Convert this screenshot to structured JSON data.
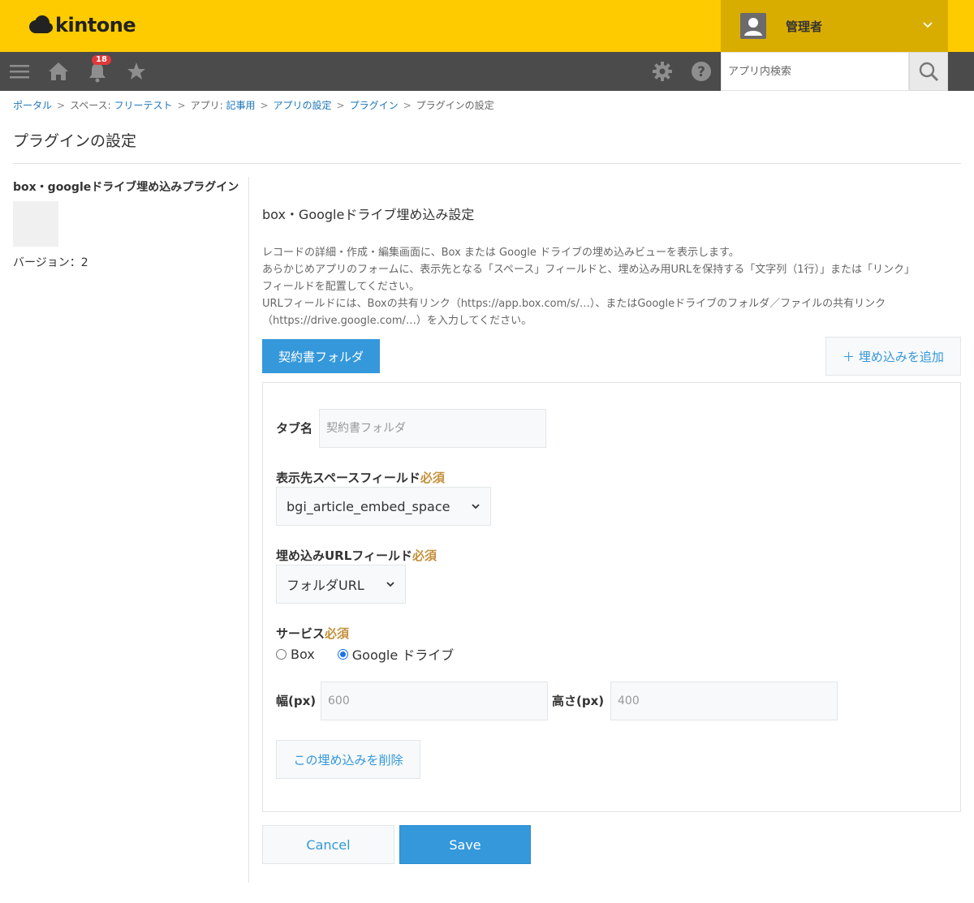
{
  "header": {
    "logo_text": "kintone",
    "user_name": "管理者",
    "notification_count": "18",
    "search_placeholder": "アプリ内検索",
    "brand_color": "#fdcb00",
    "navbar_color": "#4b4b4b"
  },
  "nav": {
    "icons": [
      "menu-icon",
      "home-icon",
      "bell-icon",
      "star-icon",
      "gear-icon",
      "help-icon",
      "search-icon"
    ]
  },
  "breadcrumb": {
    "portal": "ポータル",
    "space_prefix": "スペース: ",
    "space_name": "フリーテスト",
    "app_prefix": "アプリ: ",
    "app_name": "記事用",
    "app_settings": "アプリの設定",
    "plugins": "プラグイン",
    "current": "プラグインの設定",
    "separator": ">"
  },
  "page": {
    "title": "プラグインの設定"
  },
  "plugin": {
    "name": "box・googleドライブ埋め込みプラグイン",
    "version_label": "バージョン：2"
  },
  "settings": {
    "section_title": "box・Googleドライブ埋め込み設定",
    "description": [
      "レコードの詳細・作成・編集画面に、Box または Google ドライブの埋め込みビューを表示します。",
      "あらかじめアプリのフォームに、表示先となる「スペース」フィールドと、埋め込み用URLを保持する「文字列（1行）」または「リンク」",
      "フィールドを配置してください。",
      "URLフィールドには、Boxの共有リンク（https://app.box.com/s/…）、またはGoogleドライブのフォルダ／ファイルの共有リンク",
      "（https://drive.google.com/…）を入力してください。"
    ],
    "tab_label": "契約書フォルダ",
    "add_button": "＋ 埋め込みを追加"
  },
  "form": {
    "tab_name_label": "タブ名",
    "tab_name_placeholder": "契約書フォルダ",
    "space_field_label": "表示先スペースフィールド",
    "required_label": "必須",
    "space_field_value": "bgi_article_embed_space",
    "url_field_label": "埋め込みURLフィールド",
    "url_field_value": "フォルダURL",
    "service_label": "サービス",
    "service_options": [
      "Box",
      "Google ドライブ"
    ],
    "service_selected": "Google ドライブ",
    "width_label": "幅(px)",
    "width_placeholder": "600",
    "height_label": "高さ(px)",
    "height_placeholder": "400",
    "delete_button": "この埋め込みを削除"
  },
  "footer": {
    "cancel": "Cancel",
    "save": "Save",
    "accent_color": "#3498db"
  }
}
